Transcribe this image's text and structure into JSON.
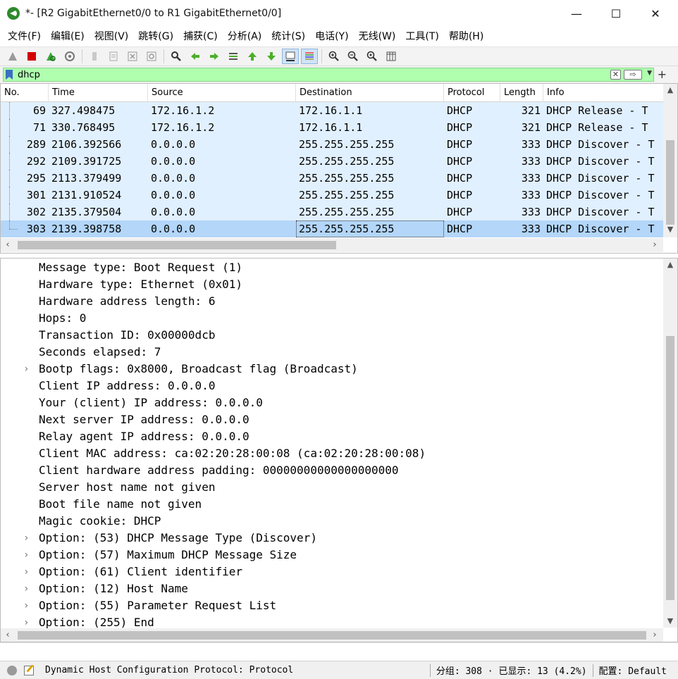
{
  "window": {
    "title": "*- [R2 GigabitEthernet0/0 to R1 GigabitEthernet0/0]",
    "minimize": "—",
    "maximize": "☐",
    "close": "✕"
  },
  "menu": [
    {
      "name": "menu-file",
      "label": "文件(F)"
    },
    {
      "name": "menu-edit",
      "label": "编辑(E)"
    },
    {
      "name": "menu-view",
      "label": "视图(V)"
    },
    {
      "name": "menu-go",
      "label": "跳转(G)"
    },
    {
      "name": "menu-capture",
      "label": "捕获(C)"
    },
    {
      "name": "menu-analyze",
      "label": "分析(A)"
    },
    {
      "name": "menu-statistics",
      "label": "统计(S)"
    },
    {
      "name": "menu-telephony",
      "label": "电话(Y)"
    },
    {
      "name": "menu-wireless",
      "label": "无线(W)"
    },
    {
      "name": "menu-tools",
      "label": "工具(T)"
    },
    {
      "name": "menu-help",
      "label": "帮助(H)"
    }
  ],
  "filter": {
    "value": "dhcp",
    "apply_label": "⇨",
    "clear_label": "✕",
    "add_label": "+"
  },
  "columns": [
    "No.",
    "Time",
    "Source",
    "Destination",
    "Protocol",
    "Length",
    "Info"
  ],
  "packets": [
    {
      "no": "69",
      "time": "327.498475",
      "src": "172.16.1.2",
      "dst": "172.16.1.1",
      "proto": "DHCP",
      "len": "321",
      "info": "DHCP Release  - T"
    },
    {
      "no": "71",
      "time": "330.768495",
      "src": "172.16.1.2",
      "dst": "172.16.1.1",
      "proto": "DHCP",
      "len": "321",
      "info": "DHCP Release  - T"
    },
    {
      "no": "289",
      "time": "2106.392566",
      "src": "0.0.0.0",
      "dst": "255.255.255.255",
      "proto": "DHCP",
      "len": "333",
      "info": "DHCP Discover - T"
    },
    {
      "no": "292",
      "time": "2109.391725",
      "src": "0.0.0.0",
      "dst": "255.255.255.255",
      "proto": "DHCP",
      "len": "333",
      "info": "DHCP Discover - T"
    },
    {
      "no": "295",
      "time": "2113.379499",
      "src": "0.0.0.0",
      "dst": "255.255.255.255",
      "proto": "DHCP",
      "len": "333",
      "info": "DHCP Discover - T"
    },
    {
      "no": "301",
      "time": "2131.910524",
      "src": "0.0.0.0",
      "dst": "255.255.255.255",
      "proto": "DHCP",
      "len": "333",
      "info": "DHCP Discover - T"
    },
    {
      "no": "302",
      "time": "2135.379504",
      "src": "0.0.0.0",
      "dst": "255.255.255.255",
      "proto": "DHCP",
      "len": "333",
      "info": "DHCP Discover - T"
    },
    {
      "no": "303",
      "time": "2139.398758",
      "src": "0.0.0.0",
      "dst": "255.255.255.255",
      "proto": "DHCP",
      "len": "333",
      "info": "DHCP Discover - T"
    }
  ],
  "details": [
    {
      "text": "Message type: Boot Request (1)",
      "expandable": false
    },
    {
      "text": "Hardware type: Ethernet (0x01)",
      "expandable": false
    },
    {
      "text": "Hardware address length: 6",
      "expandable": false
    },
    {
      "text": "Hops: 0",
      "expandable": false
    },
    {
      "text": "Transaction ID: 0x00000dcb",
      "expandable": false
    },
    {
      "text": "Seconds elapsed: 7",
      "expandable": false
    },
    {
      "text": "Bootp flags: 0x8000, Broadcast flag (Broadcast)",
      "expandable": true
    },
    {
      "text": "Client IP address: 0.0.0.0",
      "expandable": false
    },
    {
      "text": "Your (client) IP address: 0.0.0.0",
      "expandable": false
    },
    {
      "text": "Next server IP address: 0.0.0.0",
      "expandable": false
    },
    {
      "text": "Relay agent IP address: 0.0.0.0",
      "expandable": false
    },
    {
      "text": "Client MAC address: ca:02:20:28:00:08 (ca:02:20:28:00:08)",
      "expandable": false
    },
    {
      "text": "Client hardware address padding: 00000000000000000000",
      "expandable": false
    },
    {
      "text": "Server host name not given",
      "expandable": false
    },
    {
      "text": "Boot file name not given",
      "expandable": false
    },
    {
      "text": "Magic cookie: DHCP",
      "expandable": false
    },
    {
      "text": "Option: (53) DHCP Message Type (Discover)",
      "expandable": true
    },
    {
      "text": "Option: (57) Maximum DHCP Message Size",
      "expandable": true
    },
    {
      "text": "Option: (61) Client identifier",
      "expandable": true
    },
    {
      "text": "Option: (12) Host Name",
      "expandable": true
    },
    {
      "text": "Option: (55) Parameter Request List",
      "expandable": true
    },
    {
      "text": "Option: (255) End",
      "expandable": true
    }
  ],
  "status": {
    "protocol_text": "Dynamic Host Configuration Protocol: Protocol",
    "packets_text": "分组: 308 · 已显示: 13 (4.2%)",
    "profile_text": "配置: Default"
  },
  "colors": {
    "filter_valid": "#afffaf",
    "row_bg": "#e1f0fe",
    "row_selected": "#b3d6f9"
  }
}
